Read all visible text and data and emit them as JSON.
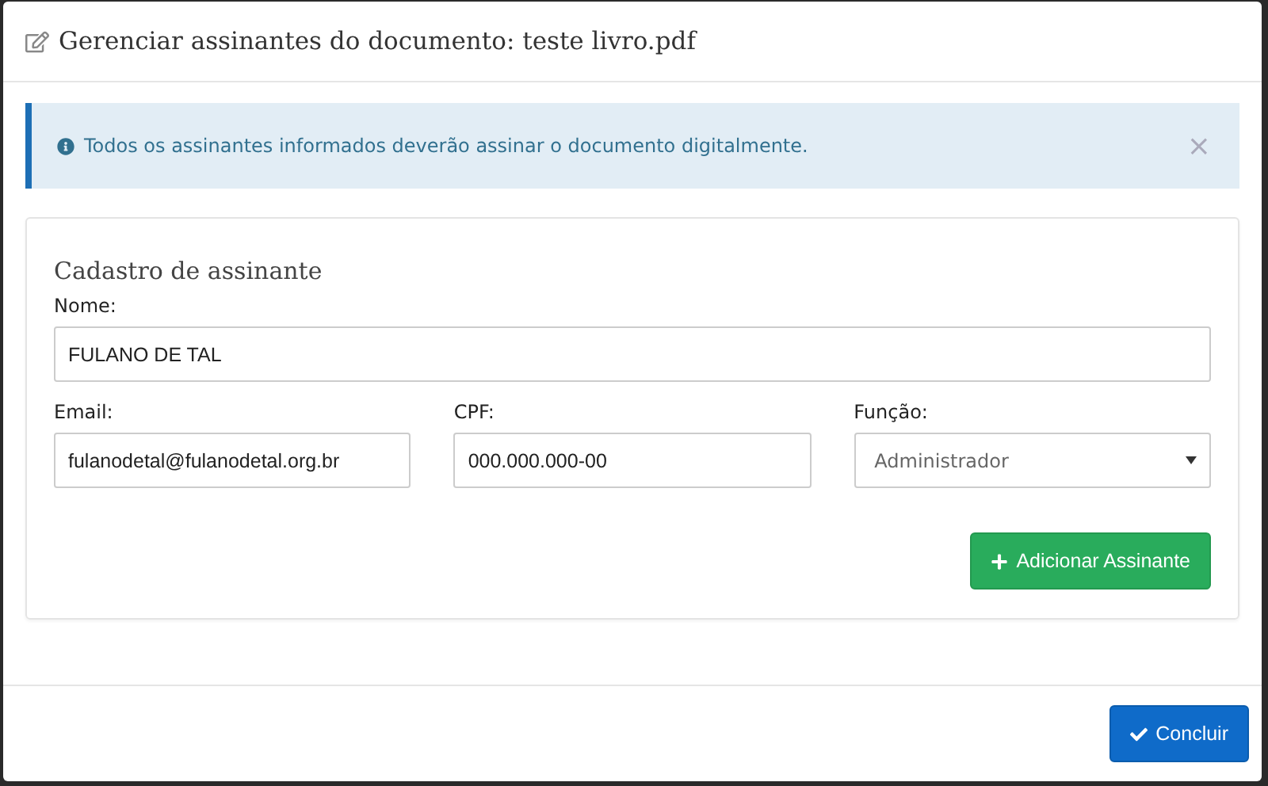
{
  "dialog": {
    "title": "Gerenciar assinantes do documento: teste livro.pdf"
  },
  "alert": {
    "text": "Todos os assinantes informados deverão assinar o documento digitalmente.",
    "close": "×"
  },
  "form": {
    "heading": "Cadastro de assinante",
    "fields": [
      {
        "kind": "text",
        "label": "Nome:",
        "value": "FULANO DE TAL"
      },
      {
        "kind": "text",
        "label": "Email:",
        "value": "fulanodetal@fulanodetal.org.br"
      },
      {
        "kind": "text",
        "label": "CPF:",
        "value": "000.000.000-00"
      },
      {
        "kind": "select",
        "label": "Função:",
        "value": "Administrador"
      }
    ],
    "add_button": "Adicionar Assinante"
  },
  "footer": {
    "button": "Concluir"
  }
}
